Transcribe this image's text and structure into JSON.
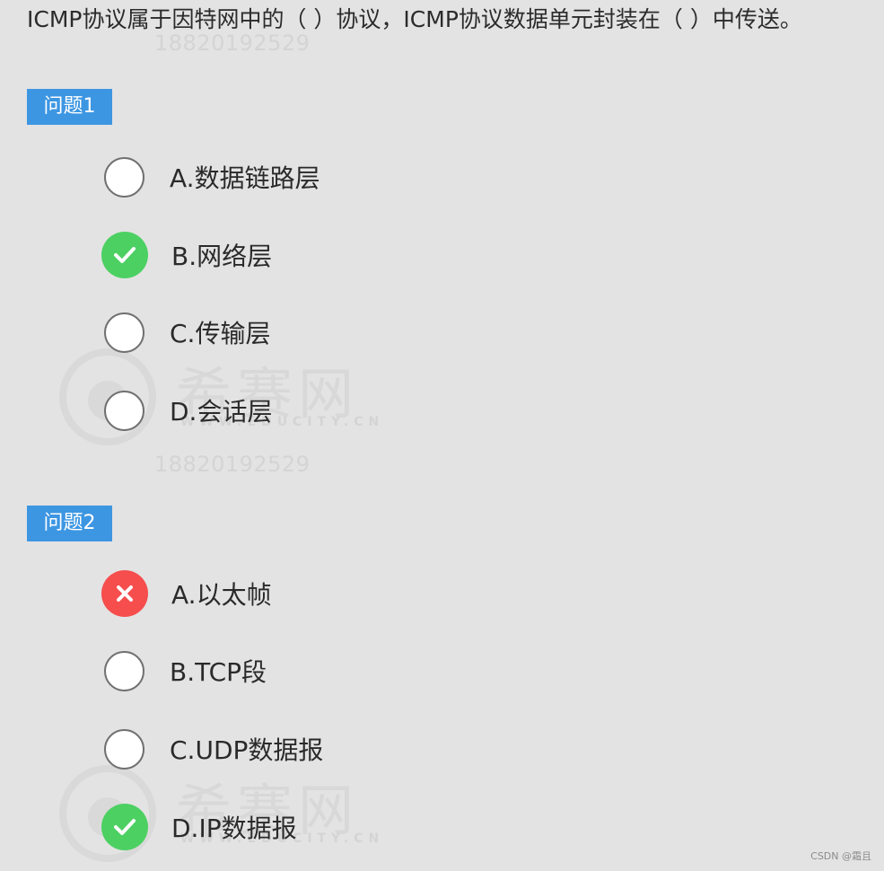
{
  "question": {
    "text": "ICMP协议属于因特网中的（ ）协议，ICMP协议数据单元封装在（ ）中传送。"
  },
  "watermark": {
    "number": "18820192529",
    "site_name": "希赛网",
    "site_url": "WWW.EDUCITY.CN"
  },
  "questions": [
    {
      "label": "问题1",
      "options": [
        {
          "label": "A.数据链路层",
          "status": "unselected",
          "icon": "empty-radio"
        },
        {
          "label": "B.网络层",
          "status": "correct",
          "icon": "checkmark-icon"
        },
        {
          "label": "C.传输层",
          "status": "unselected",
          "icon": "empty-radio"
        },
        {
          "label": "D.会话层",
          "status": "unselected",
          "icon": "empty-radio"
        }
      ]
    },
    {
      "label": "问题2",
      "options": [
        {
          "label": "A.以太帧",
          "status": "wrong",
          "icon": "cross-icon"
        },
        {
          "label": "B.TCP段",
          "status": "unselected",
          "icon": "empty-radio"
        },
        {
          "label": "C.UDP数据报",
          "status": "unselected",
          "icon": "empty-radio"
        },
        {
          "label": "D.IP数据报",
          "status": "correct",
          "icon": "checkmark-icon"
        }
      ]
    }
  ],
  "footer": {
    "credit": "CSDN @霜且"
  },
  "colors": {
    "background": "#e3e3e3",
    "badge": "#3d96e2",
    "correct": "#4cd062",
    "wrong": "#f64d4d"
  }
}
